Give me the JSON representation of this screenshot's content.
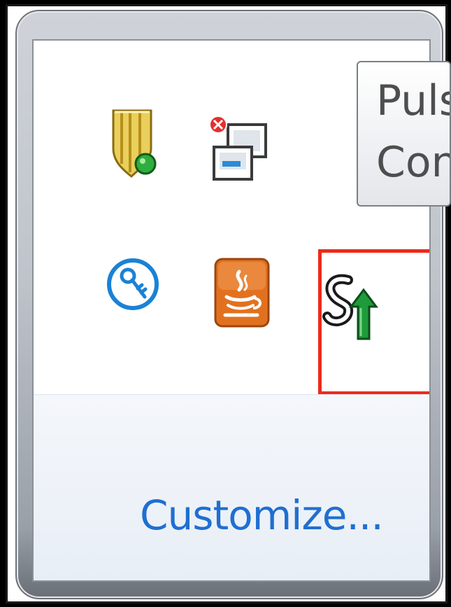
{
  "tray_flyout": {
    "icons": [
      {
        "icon": "shield-security-icon",
        "color": "#d8b42a"
      },
      {
        "icon": "network-disconnected-icon",
        "color": "#e23030"
      },
      {
        "icon": "key-icon",
        "color": "#1a82d6"
      },
      {
        "icon": "java-icon",
        "color": "#e07020"
      },
      {
        "icon": "pulse-secure-icon",
        "color": "#1e9b3a"
      }
    ],
    "selected_icon": "pulse-secure-icon",
    "customize_label": "Customize..."
  },
  "tooltip": {
    "line1": "Puls",
    "line2": "Con"
  },
  "colors": {
    "link": "#1f6fd1",
    "selection": "#ee2a1a"
  }
}
